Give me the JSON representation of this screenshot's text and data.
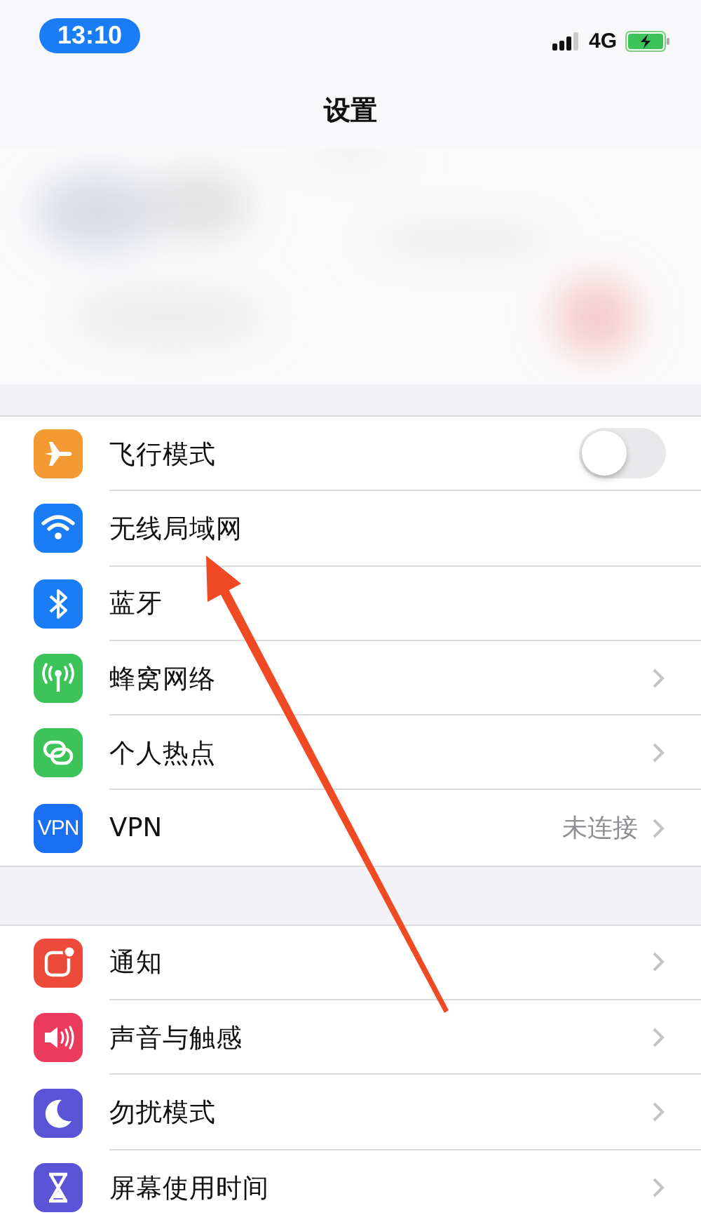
{
  "status_bar": {
    "time": "13:10",
    "network": "4G"
  },
  "title": "设置",
  "groups": [
    {
      "rows": [
        {
          "label": "飞行模式",
          "color": "#f39a33",
          "kind": "toggle",
          "on": false
        },
        {
          "label": "无线局域网",
          "color": "#1a7df5",
          "kind": "hidden"
        },
        {
          "label": "蓝牙",
          "color": "#1a7df5",
          "kind": "hidden"
        },
        {
          "label": "蜂窝网络",
          "color": "#3cc35a",
          "kind": "link"
        },
        {
          "label": "个人热点",
          "color": "#3cc35a",
          "kind": "link"
        },
        {
          "label": "VPN",
          "color": "#1a6ff2",
          "kind": "link",
          "value": "未连接",
          "badge": "VPN"
        }
      ]
    },
    {
      "rows": [
        {
          "label": "通知",
          "color": "#ec4a3b",
          "kind": "link"
        },
        {
          "label": "声音与触感",
          "color": "#ec3a5f",
          "kind": "link"
        },
        {
          "label": "勿扰模式",
          "color": "#5a55d6",
          "kind": "link"
        },
        {
          "label": "屏幕使用时间",
          "color": "#5a55d6",
          "kind": "link"
        }
      ]
    }
  ]
}
